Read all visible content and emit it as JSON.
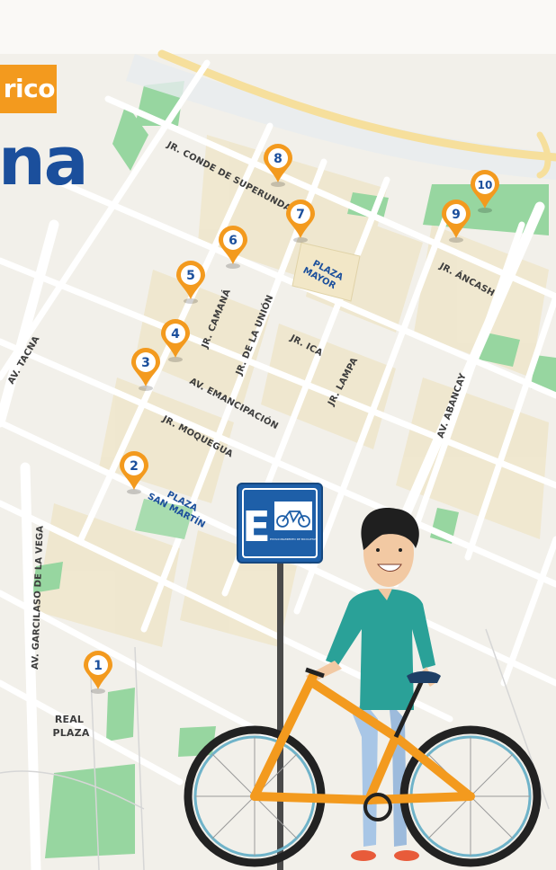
{
  "badge_text": "rico",
  "headline_text": "na",
  "streets": [
    {
      "id": "jr-conde-de-superunda",
      "label": "JR. CONDE DE SUPERUNDA"
    },
    {
      "id": "av-tacna",
      "label": "AV. TACNA"
    },
    {
      "id": "jr-camana",
      "label": "JR. CAMANÁ"
    },
    {
      "id": "jr-de-la-union",
      "label": "JR. DE LA UNIÓN"
    },
    {
      "id": "jr-ica",
      "label": "JR. ICA"
    },
    {
      "id": "jr-lampa",
      "label": "JR. LAMPA"
    },
    {
      "id": "jr-ancash",
      "label": "JR. ÁNCASH"
    },
    {
      "id": "av-abancay",
      "label": "AV. ABANCAY"
    },
    {
      "id": "av-emancipacion",
      "label": "AV. EMANCIPACIÓN"
    },
    {
      "id": "jr-moquegua",
      "label": "JR. MOQUEGUA"
    },
    {
      "id": "av-garcilaso-de-la-vega",
      "label": "AV. GARCILASO DE LA VEGA"
    }
  ],
  "places": {
    "plaza_mayor": [
      "PLAZA",
      "MAYOR"
    ],
    "plaza_san_martin": [
      "PLAZA",
      "SAN MARTÍN"
    ],
    "real_plaza": [
      "REAL",
      "PLAZA"
    ]
  },
  "markers": [
    {
      "number": "1"
    },
    {
      "number": "2"
    },
    {
      "number": "3"
    },
    {
      "number": "4"
    },
    {
      "number": "5"
    },
    {
      "number": "6"
    },
    {
      "number": "7"
    },
    {
      "number": "8"
    },
    {
      "number": "9"
    },
    {
      "number": "10"
    }
  ],
  "parking_sign": {
    "letter": "E",
    "caption": "ESTACIONAMIENTO DE BICICLETAS"
  },
  "colors": {
    "pin_orange": "#f39a1e",
    "brand_blue": "#1b4f9c",
    "sign_blue": "#1e5fa8",
    "park_green": "#8fd19a",
    "avenue_yellow": "#f6e3a6",
    "shirt_teal": "#2aa198"
  },
  "icons": [
    "map-pin-icon",
    "bicycle-icon",
    "parking-sign-icon"
  ]
}
